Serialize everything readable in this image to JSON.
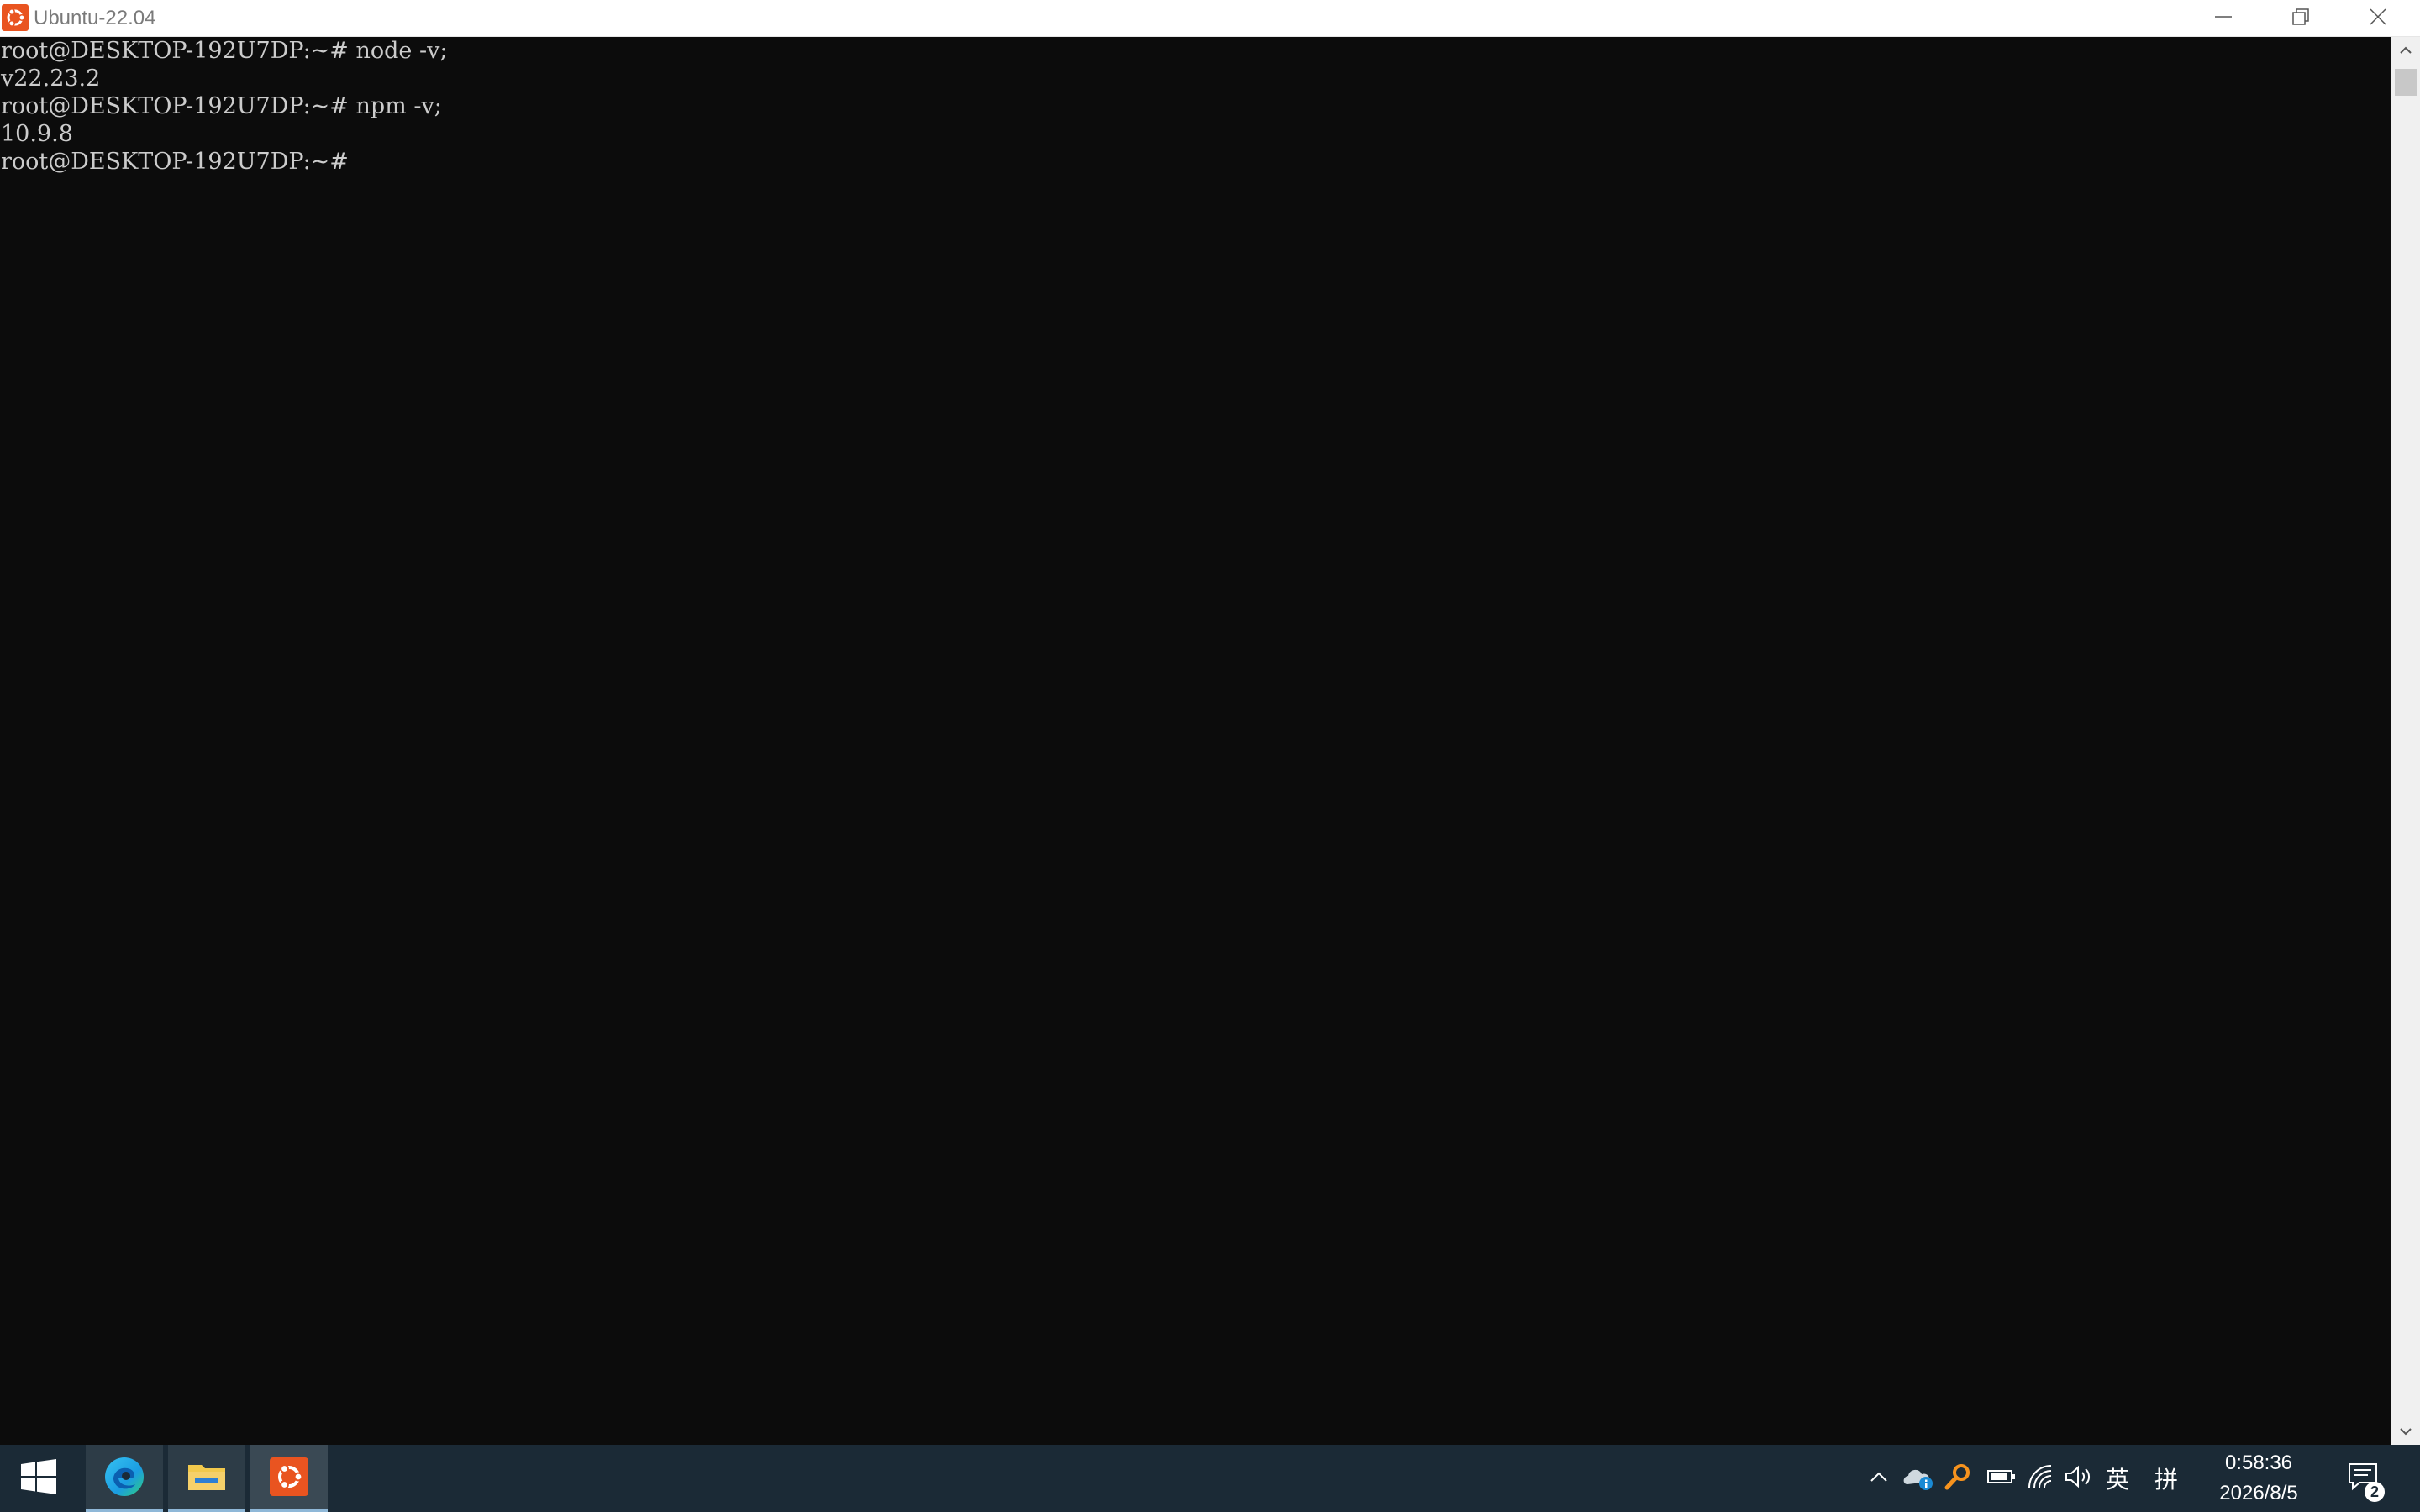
{
  "window": {
    "title": "Ubuntu-22.04",
    "app_icon": "ubuntu-icon",
    "controls": [
      "minimize-icon",
      "restore-icon",
      "close-icon"
    ]
  },
  "terminal": {
    "lines": [
      "root@DESKTOP-192U7DP:~# node -v;",
      "v22.23.2",
      "root@DESKTOP-192U7DP:~# npm -v;",
      "10.9.8",
      "root@DESKTOP-192U7DP:~#"
    ]
  },
  "taskbar": {
    "apps": [
      {
        "name": "start-button",
        "icon": "windows-icon"
      },
      {
        "name": "edge",
        "icon": "edge-icon"
      },
      {
        "name": "file-explorer",
        "icon": "folder-icon"
      },
      {
        "name": "ubuntu",
        "icon": "ubuntu-icon"
      }
    ],
    "tray": {
      "ime_lang": "英",
      "ime_mode": "拼",
      "time": "0:58:36",
      "date": "2026/8/5",
      "notification_count": "2"
    }
  },
  "colors": {
    "terminal_bg": "#0c0c0c",
    "terminal_fg": "#cccccc",
    "taskbar_bg": "#1b2a36",
    "ubuntu_orange": "#e95420"
  }
}
